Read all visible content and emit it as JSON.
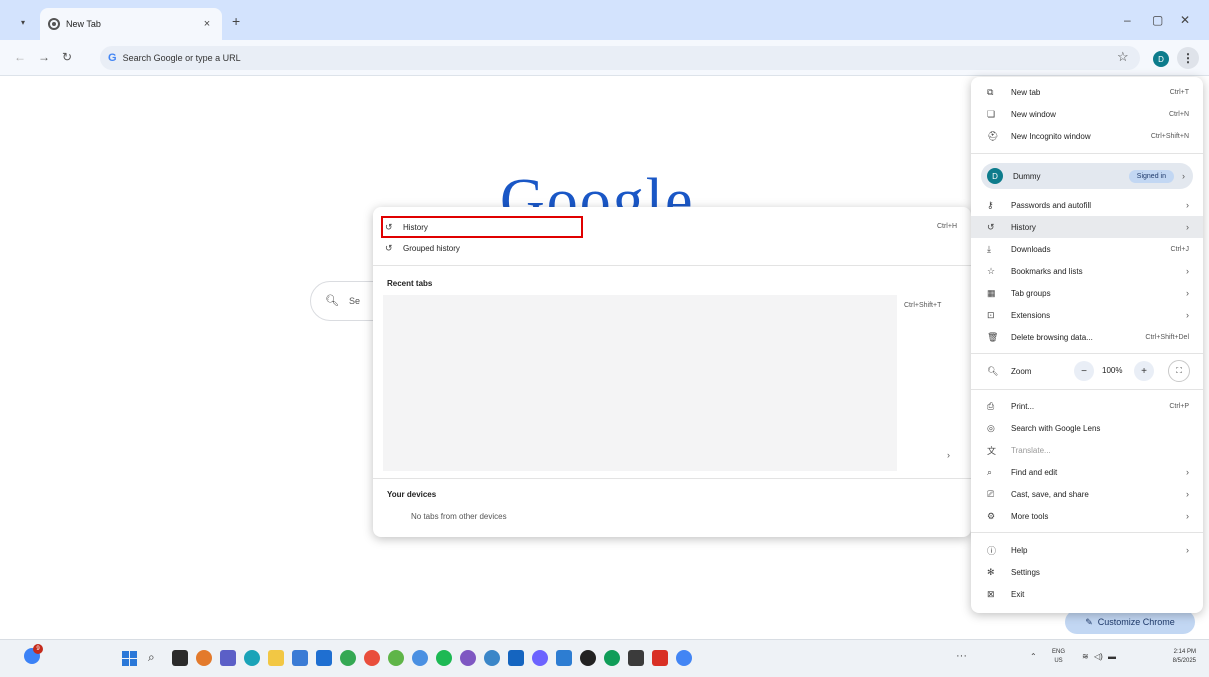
{
  "tab": {
    "title": "New Tab"
  },
  "toolbar": {
    "omnibox_placeholder": "Search Google or type a URL",
    "avatar_letter": "D"
  },
  "page": {
    "logo_text": "Google",
    "search_placeholder": "Se",
    "customize_label": "Customize Chrome"
  },
  "history_submenu": {
    "items": [
      {
        "label": "History",
        "shortcut": "Ctrl+H"
      },
      {
        "label": "Grouped history",
        "shortcut": ""
      }
    ],
    "recent_tabs_heading": "Recent tabs",
    "recent_shortcut": "Ctrl+Shift+T",
    "your_devices_heading": "Your devices",
    "no_devices_text": "No tabs from other devices"
  },
  "main_menu": {
    "group1": [
      {
        "label": "New tab",
        "shortcut": "Ctrl+T"
      },
      {
        "label": "New window",
        "shortcut": "Ctrl+N"
      },
      {
        "label": "New Incognito window",
        "shortcut": "Ctrl+Shift+N"
      }
    ],
    "profile": {
      "name": "Dummy",
      "status": "Signed in",
      "avatar_letter": "D"
    },
    "group2": [
      {
        "label": "Passwords and autofill",
        "shortcut": ""
      },
      {
        "label": "History",
        "shortcut": ""
      },
      {
        "label": "Downloads",
        "shortcut": "Ctrl+J"
      },
      {
        "label": "Bookmarks and lists",
        "shortcut": ""
      },
      {
        "label": "Tab groups",
        "shortcut": ""
      },
      {
        "label": "Extensions",
        "shortcut": ""
      },
      {
        "label": "Delete browsing data...",
        "shortcut": "Ctrl+Shift+Del"
      }
    ],
    "zoom": {
      "label": "Zoom",
      "value": "100%"
    },
    "group3": [
      {
        "label": "Print...",
        "shortcut": "Ctrl+P"
      },
      {
        "label": "Search with Google Lens",
        "shortcut": ""
      },
      {
        "label": "Translate...",
        "shortcut": ""
      },
      {
        "label": "Find and edit",
        "shortcut": ""
      },
      {
        "label": "Cast, save, and share",
        "shortcut": ""
      },
      {
        "label": "More tools",
        "shortcut": ""
      }
    ],
    "group4": [
      {
        "label": "Help",
        "shortcut": ""
      },
      {
        "label": "Settings",
        "shortcut": ""
      },
      {
        "label": "Exit",
        "shortcut": ""
      }
    ]
  },
  "taskbar": {
    "lang_top": "ENG",
    "lang_bottom": "US",
    "time": "2:14 PM",
    "date": "8/5/2025",
    "badge": "9",
    "more": "···"
  },
  "colors": {
    "accent": "#0b57d0",
    "highlight_box": "#e00000",
    "tabstrip": "#d3e3fd"
  }
}
